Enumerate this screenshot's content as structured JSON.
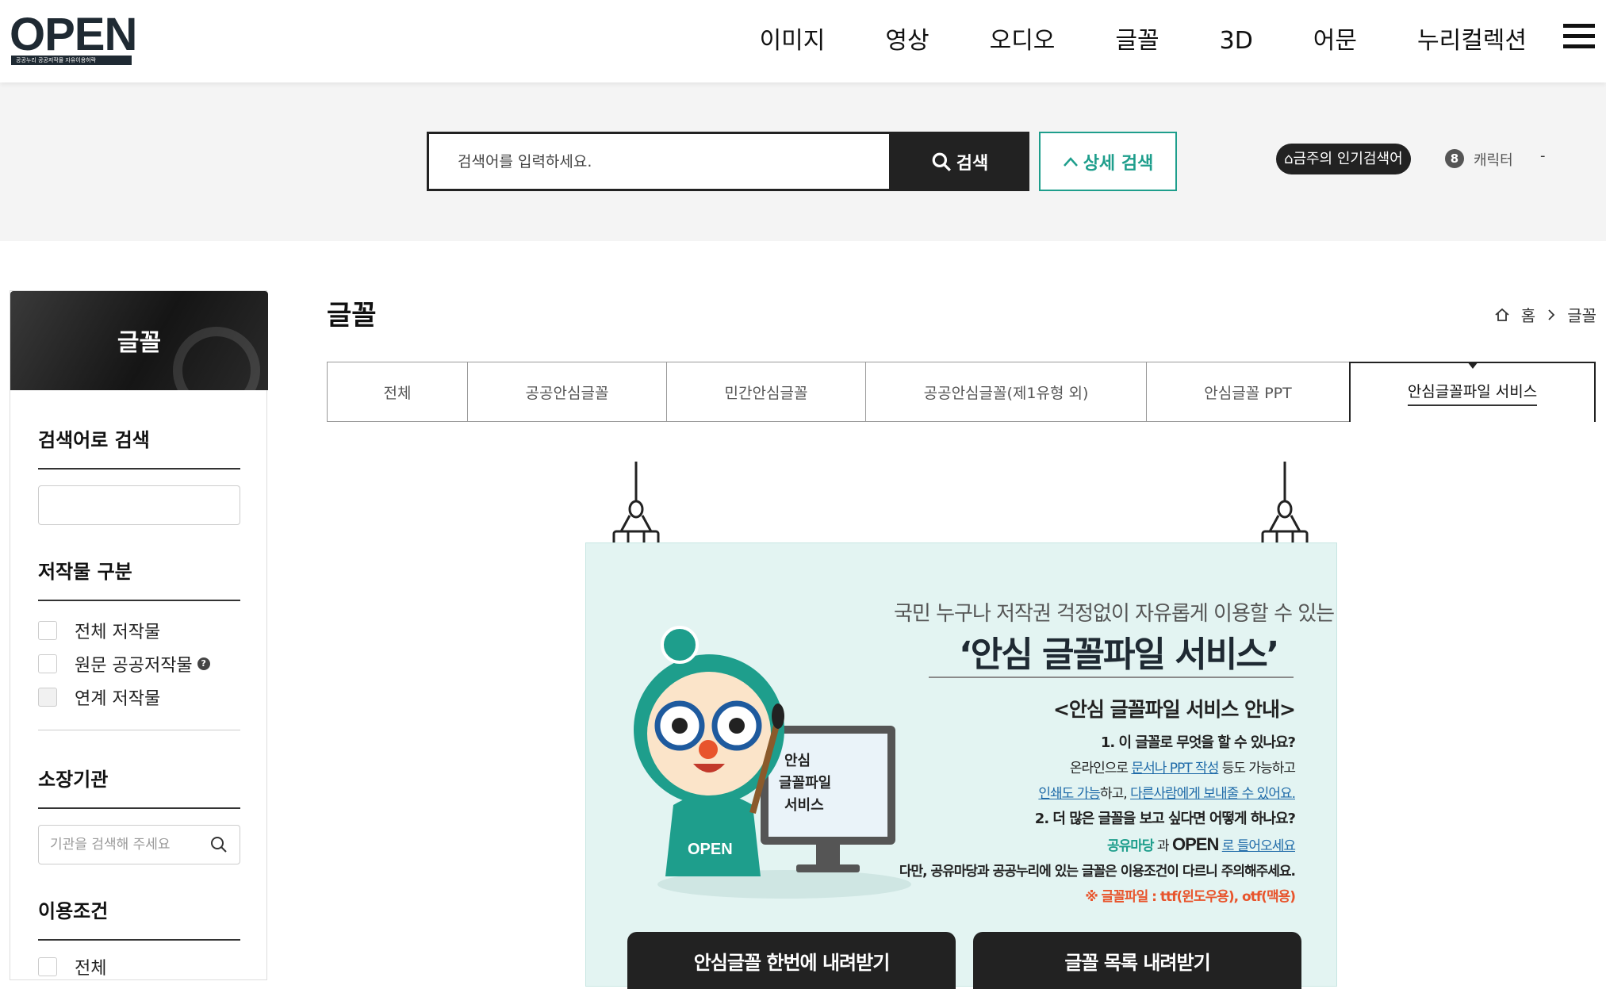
{
  "header": {
    "logo_text": "OPEN",
    "logo_sub": "공공누리  공공저작물 자유이용허락",
    "menu": [
      "이미지",
      "영상",
      "오디오",
      "글꼴",
      "3D",
      "어문",
      "누리컬렉션"
    ]
  },
  "search": {
    "placeholder": "검색어를 입력하세요.",
    "button_label": "검색",
    "detail_label": "상세 검색",
    "popular_label": "금주의 인기검색어",
    "popular_rank": "8",
    "popular_word": "캐릭터",
    "popular_dash": "-"
  },
  "sidebar": {
    "title": "글꼴",
    "search_title": "검색어로 검색",
    "category_title": "저작물 구분",
    "categories": [
      "전체 저작물",
      "원문 공공저작물",
      "연계 저작물"
    ],
    "institution_title": "소장기관",
    "institution_placeholder": "기관을 검색해 주세요",
    "usage_title": "이용조건",
    "usage_options": [
      "전체"
    ]
  },
  "main": {
    "page_title": "글꼴",
    "breadcrumb": [
      "홈",
      "글꼴"
    ],
    "tabs": [
      "전체",
      "공공안심글꼴",
      "민간안심글꼴",
      "공공안심글꼴(제1유형 외)",
      "안심글꼴 PPT",
      "안심글꼴파일 서비스"
    ],
    "active_tab": 5
  },
  "poster": {
    "subtitle": "국민 누구나 저작권 걱정없이 자유롭게 이용할 수 있는",
    "title": "‘안심 글꼴파일 서비스’",
    "info_title": "<안심 글꼴파일 서비스 안내>",
    "q1": "1. 이 글꼴로 무엇을 할 수 있나요?",
    "a1_pre": "온라인으로 ",
    "a1_link": "문서나 PPT 작성",
    "a1_post": " 등도 가능하고",
    "a2_link1": "인쇄도 가능",
    "a2_mid": "하고, ",
    "a2_link2": "다른사람에게 보내줄 수 있어요.",
    "q2": "2. 더 많은 글꼴을 보고 싶다면 어떻게 하나요?",
    "a3_brand1": "공유마당",
    "a3_and": " 과 ",
    "a3_brand2": "OPEN",
    "a3_link": "로 들어오세요",
    "a4": "다만, 공유마당과 공공누리에 있는 글꼴은 이용조건이 다르니 주의해주세요.",
    "note": "※ 글꼴파일 : ttf(윈도우용), otf(맥용)",
    "board_text": [
      "안심",
      "글꼴파일",
      "서비스"
    ],
    "mascot_badge": "OPEN",
    "btn_download_all": "안심글꼴 한번에 내려받기",
    "btn_download_list": "글꼴 목록 내려받기"
  }
}
